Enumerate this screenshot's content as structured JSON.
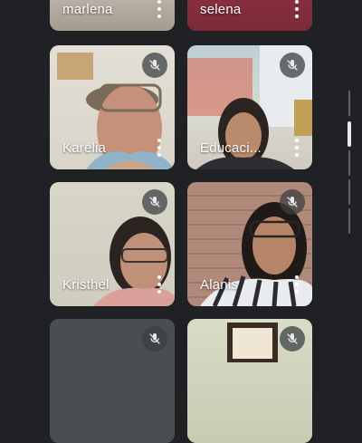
{
  "participants": [
    {
      "name": "marlena",
      "muted": false
    },
    {
      "name": "selena",
      "muted": false
    },
    {
      "name": "Karelia",
      "muted": true
    },
    {
      "name": "Educaci...",
      "muted": true
    },
    {
      "name": "Kristhel",
      "muted": true
    },
    {
      "name": "Alanis",
      "muted": true
    },
    {
      "name": "",
      "muted": true
    },
    {
      "name": "",
      "muted": true
    }
  ],
  "colors": {
    "background": "#202124",
    "tile_overlay": "#3c4043",
    "scrollbar_thumb": "#e8eaed"
  },
  "icons": {
    "mute": "mic-off-icon",
    "more": "more-vert-icon"
  }
}
